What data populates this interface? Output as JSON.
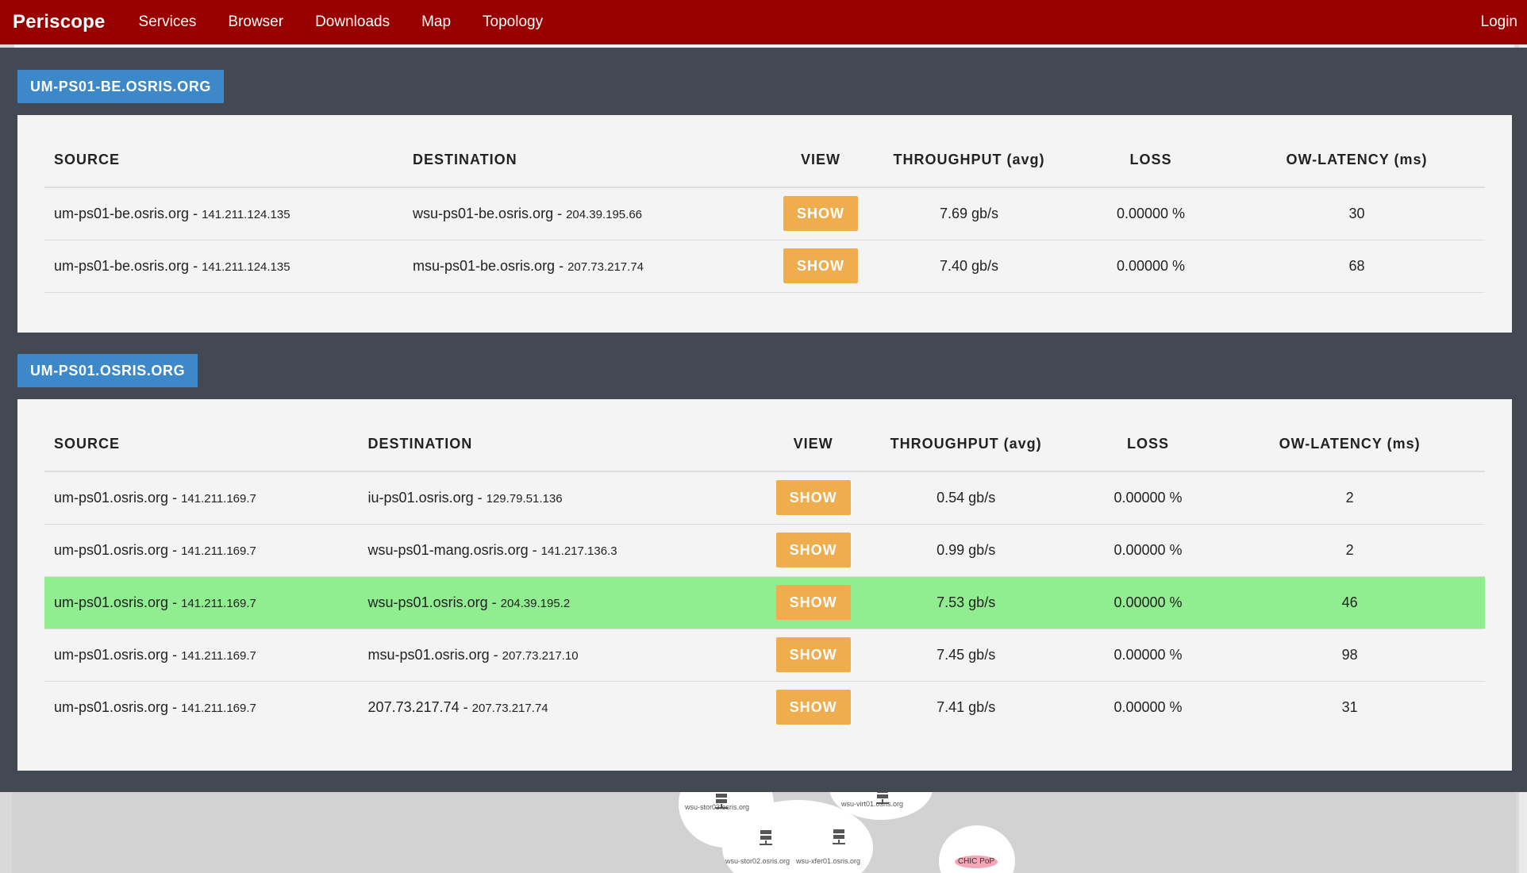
{
  "nav": {
    "brand": "Periscope",
    "links": [
      "Services",
      "Browser",
      "Downloads",
      "Map",
      "Topology"
    ],
    "login": "Login"
  },
  "columns": [
    "SOURCE",
    "DESTINATION",
    "VIEW",
    "THROUGHPUT (avg)",
    "LOSS",
    "OW-LATENCY (ms)"
  ],
  "panels": [
    {
      "title": "UM-PS01-BE.OSRIS.ORG",
      "rows": [
        {
          "src_host": "um-ps01-be.osris.org",
          "src_ip": "141.211.124.135",
          "dst_host": "wsu-ps01-be.osris.org",
          "dst_ip": "204.39.195.66",
          "view": "SHOW",
          "throughput": "7.69 gb/s",
          "loss": "0.00000 %",
          "latency": "30"
        },
        {
          "src_host": "um-ps01-be.osris.org",
          "src_ip": "141.211.124.135",
          "dst_host": "msu-ps01-be.osris.org",
          "dst_ip": "207.73.217.74",
          "view": "SHOW",
          "throughput": "7.40 gb/s",
          "loss": "0.00000 %",
          "latency": "68"
        }
      ]
    },
    {
      "title": "UM-PS01.OSRIS.ORG",
      "rows": [
        {
          "src_host": "um-ps01.osris.org",
          "src_ip": "141.211.169.7",
          "dst_host": "iu-ps01.osris.org",
          "dst_ip": "129.79.51.136",
          "view": "SHOW",
          "throughput": "0.54 gb/s",
          "loss": "0.00000 %",
          "latency": "2"
        },
        {
          "src_host": "um-ps01.osris.org",
          "src_ip": "141.211.169.7",
          "dst_host": "wsu-ps01-mang.osris.org",
          "dst_ip": "141.217.136.3",
          "view": "SHOW",
          "throughput": "0.99 gb/s",
          "loss": "0.00000 %",
          "latency": "2"
        },
        {
          "src_host": "um-ps01.osris.org",
          "src_ip": "141.211.169.7",
          "dst_host": "wsu-ps01.osris.org",
          "dst_ip": "204.39.195.2",
          "view": "SHOW",
          "throughput": "7.53 gb/s",
          "loss": "0.00000 %",
          "latency": "46",
          "highlight": true
        },
        {
          "src_host": "um-ps01.osris.org",
          "src_ip": "141.211.169.7",
          "dst_host": "msu-ps01.osris.org",
          "dst_ip": "207.73.217.10",
          "view": "SHOW",
          "throughput": "7.45 gb/s",
          "loss": "0.00000 %",
          "latency": "98"
        },
        {
          "src_host": "um-ps01.osris.org",
          "src_ip": "141.211.169.7",
          "dst_host": "207.73.217.74",
          "dst_ip": "207.73.217.74",
          "view": "SHOW",
          "throughput": "7.41 gb/s",
          "loss": "0.00000 %",
          "latency": "31"
        }
      ]
    }
  ],
  "map_nodes": [
    "wsu-stor03.osris.org",
    "wsu-virt01.osris.org",
    "wsu-stor02.osris.org",
    "wsu-xfer01.osris.org",
    "CHIC PoP"
  ],
  "colors": {
    "navbar": "#990000",
    "tag": "#3d88c9",
    "button": "#f0ad4e",
    "highlight": "#90ee90",
    "overlay": "#434952"
  }
}
